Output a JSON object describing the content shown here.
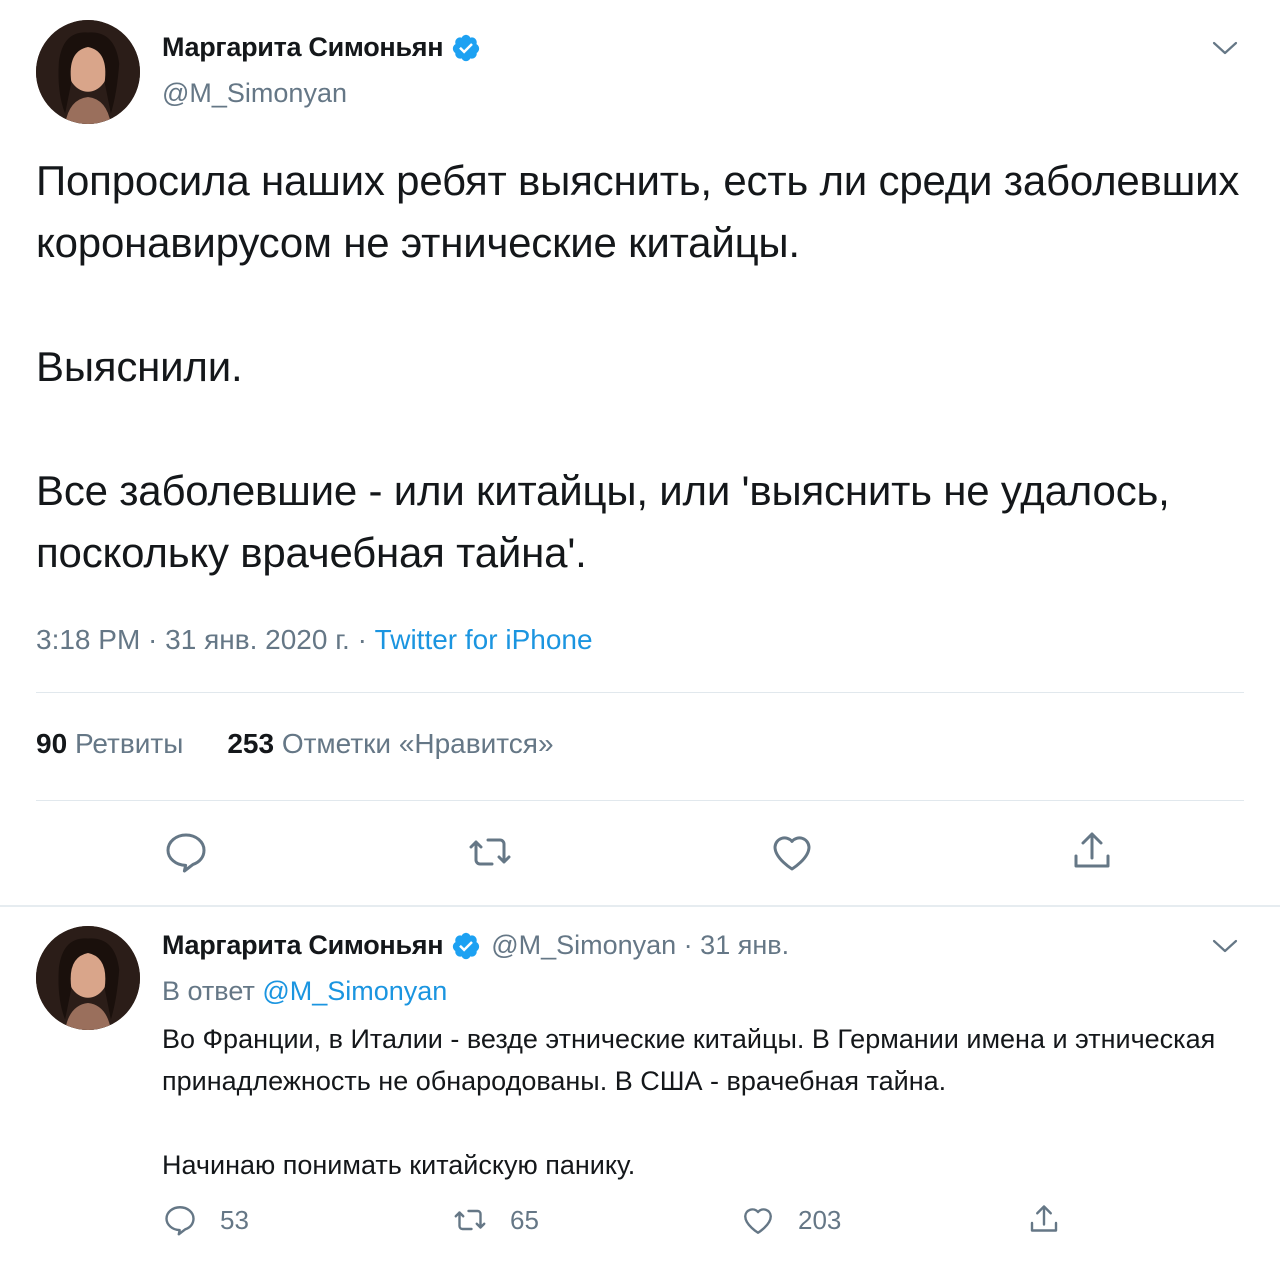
{
  "main_tweet": {
    "author_name": "Маргарита Симоньян",
    "author_handle": "@M_Simonyan",
    "text": "Попросила наших ребят выяснить, есть ли среди заболевших коронавирусом не этнические китайцы.\n\nВыяснили.\n\nВсе заболевшие - или китайцы, или 'выяснить не удалось, поскольку врачебная тайна'.",
    "time": "3:18 PM · 31 янв. 2020 г. · ",
    "source": "Twitter for iPhone",
    "retweets_count": "90",
    "retweets_label": "Ретвиты",
    "likes_count": "253",
    "likes_label": "Отметки «Нравится»"
  },
  "reply_tweet": {
    "author_name": "Маргарита Симоньян",
    "handle_date": "@M_Simonyan · 31 янв.",
    "reply_to_prefix": "В ответ ",
    "reply_to_mention": "@M_Simonyan",
    "text": "Во Франции, в Италии - везде этнические китайцы. В Германии имена и этническая принадлежность не обнародованы. В США - врачебная тайна.\n\nНачинаю понимать китайскую панику.",
    "replies": "53",
    "retweets": "65",
    "likes": "203"
  },
  "colors": {
    "accent": "#1b95e0",
    "secondary_text": "#657786",
    "primary_text": "#14171a",
    "verified": "#1da1f2"
  },
  "icons": [
    "verified-badge-icon",
    "chevron-down-icon",
    "reply-icon",
    "retweet-icon",
    "like-icon",
    "share-icon"
  ]
}
